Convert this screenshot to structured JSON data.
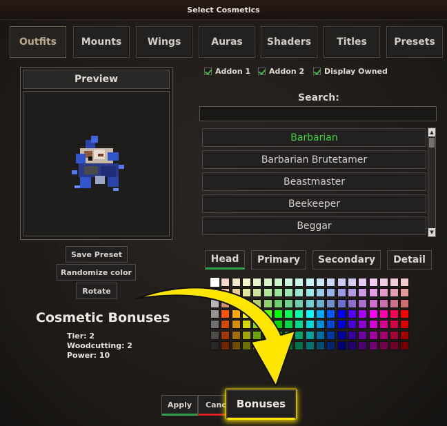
{
  "window": {
    "title": "Select Cosmetics"
  },
  "tabs": [
    "Outfits",
    "Mounts",
    "Wings",
    "Auras",
    "Shaders",
    "Titles",
    "Presets"
  ],
  "active_tab": "Outfits",
  "preview": {
    "title": "Preview",
    "buttons": {
      "save_preset": "Save Preset",
      "randomize_color": "Randomize color",
      "rotate": "Rotate"
    }
  },
  "filters": [
    {
      "label": "Addon 1",
      "checked": true
    },
    {
      "label": "Addon 2",
      "checked": true
    },
    {
      "label": "Display Owned",
      "checked": true
    }
  ],
  "search": {
    "label": "Search:",
    "value": ""
  },
  "outfit_list": {
    "items": [
      "Barbarian",
      "Barbarian Brutetamer",
      "Beastmaster",
      "Beekeeper",
      "Beggar"
    ],
    "selected": "Barbarian",
    "scroll_up_icon": "triangle-up-icon",
    "scroll_down_icon": "triangle-down-icon"
  },
  "color_parts": [
    "Head",
    "Primary",
    "Secondary",
    "Detail"
  ],
  "active_color_part": "Head",
  "cosmetic_bonuses": {
    "title": "Cosmetic Bonuses",
    "lines": [
      "Tier: 2",
      "Woodcutting: 2",
      "Power: 10"
    ]
  },
  "bottom_buttons": {
    "apply": "Apply",
    "cancel": "Cancel",
    "bonuses": "Bonuses"
  },
  "colors": {
    "selected_item": "#3fd23f",
    "active_underline": "#2fa34a",
    "apply_underline": "#2fa34a",
    "cancel_underline": "#d42020",
    "highlight": "#ffe600"
  }
}
